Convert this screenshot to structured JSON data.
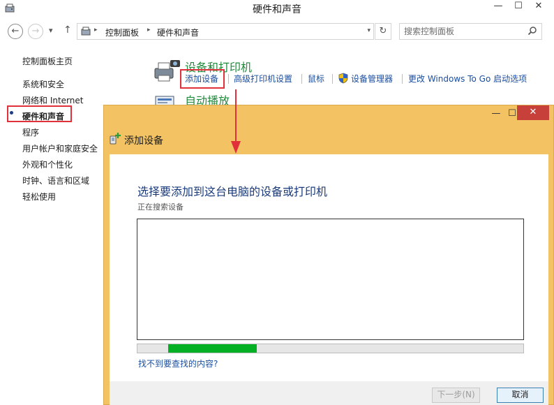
{
  "window": {
    "title": "硬件和声音",
    "minimize_glyph": "—",
    "maximize_glyph": "☐",
    "close_glyph": "✕"
  },
  "nav": {
    "back_glyph": "←",
    "forward_glyph": "→",
    "recent_glyph": "▾",
    "up_glyph": "↑"
  },
  "address": {
    "crumbs": [
      "控制面板",
      "硬件和声音"
    ],
    "separator": "▸",
    "dropdown_glyph": "▾",
    "refresh_glyph": "↻"
  },
  "search": {
    "placeholder": "搜索控制面板",
    "icon": "search-icon"
  },
  "sidebar": {
    "items": [
      {
        "label": "控制面板主页"
      },
      {
        "label": "系统和安全"
      },
      {
        "label": "网络和 Internet"
      },
      {
        "label": "硬件和声音",
        "active": true
      },
      {
        "label": "程序"
      },
      {
        "label": "用户帐户和家庭安全"
      },
      {
        "label": "外观和个性化"
      },
      {
        "label": "时钟、语言和区域"
      },
      {
        "label": "轻松使用"
      }
    ]
  },
  "category": {
    "title": "设备和打印机",
    "links": [
      "添加设备",
      "高级打印机设置",
      "鼠标",
      "设备管理器",
      "更改 Windows To Go 启动选项"
    ],
    "autoplay_title": "自动播放"
  },
  "dialog": {
    "title": "添加设备",
    "heading": "选择要添加到这台电脑的设备或打印机",
    "status": "正在搜索设备",
    "progress": 0.23,
    "progress_offset": 0.08,
    "help_link": "找不到要查找的内容?",
    "next_button": "下一步(N)",
    "cancel_button": "取消",
    "minimize_glyph": "—",
    "maximize_glyph": "☐",
    "close_glyph": "✕"
  },
  "colors": {
    "accent_red": "#e0303a",
    "category_green": "#1f8a3a",
    "link_blue": "#1a4ea0",
    "dialog_frame": "#f3c363",
    "progress_green": "#06b025"
  }
}
